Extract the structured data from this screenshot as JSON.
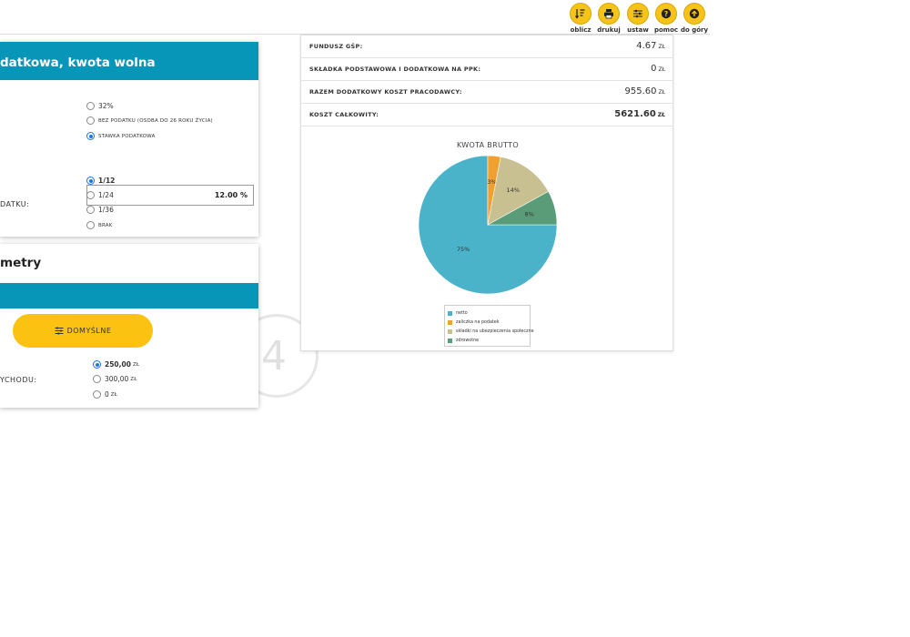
{
  "toolbar": {
    "buttons": [
      {
        "label": "oblicz",
        "icon": "sort-calc-icon"
      },
      {
        "label": "drukuj",
        "icon": "printer-icon"
      },
      {
        "label": "ustaw",
        "icon": "sliders-icon"
      },
      {
        "label": "pomoc",
        "icon": "help-icon"
      },
      {
        "label": "do góry",
        "icon": "arrow-up-icon"
      }
    ]
  },
  "tax_card": {
    "header": "datkowa, kwota wolna",
    "options": {
      "rate32": "32%",
      "no_tax": "bez podatku (osoba do 26 roku życia)",
      "tax_rate": "stawka podatkowa"
    },
    "rate_input_value": "12.00 %",
    "side_label": "DATKU:",
    "fractions": [
      "1/12",
      "1/24",
      "1/36",
      "brak"
    ],
    "selected_fraction": "1/12"
  },
  "params_card": {
    "title": "metry",
    "default_button": "DOMYŚLNE",
    "side_label": "YCHODU:",
    "costs": [
      {
        "value": "250,00",
        "unit": "ZŁ",
        "selected": true
      },
      {
        "value": "300,00",
        "unit": "ZŁ",
        "selected": false
      },
      {
        "value": "0",
        "unit": "ZŁ",
        "selected": false
      }
    ]
  },
  "watermark": "4",
  "summary": {
    "rows": [
      {
        "label": "Fundusz GŚP:",
        "value": "4.67",
        "unit": "ZŁ",
        "bold": false
      },
      {
        "label": "Składka podstawowa i dodatkowa na PPK:",
        "value": "0",
        "unit": "ZŁ",
        "bold": false
      },
      {
        "label": "Razem dodatkowy koszt pracodawcy:",
        "value": "955.60",
        "unit": "ZŁ",
        "bold": false
      },
      {
        "label": "Koszt całkowity:",
        "value": "5621.60",
        "unit": "ZŁ",
        "bold": true
      }
    ]
  },
  "chart_data": {
    "type": "pie",
    "title": "KWOTA BRUTTO",
    "slices": [
      {
        "name": "netto",
        "value": 75,
        "label": "75%",
        "color": "#4ab3c9"
      },
      {
        "name": "zaliczka na podatek",
        "value": 3,
        "label": "3%",
        "color": "#f0a030"
      },
      {
        "name": "składki na ubezpieczenia społeczne",
        "value": 14,
        "label": "14%",
        "color": "#c8c090"
      },
      {
        "name": "zdrowotne",
        "value": 8,
        "label": "8%",
        "color": "#5a9c78"
      }
    ],
    "legend": "bottom"
  }
}
